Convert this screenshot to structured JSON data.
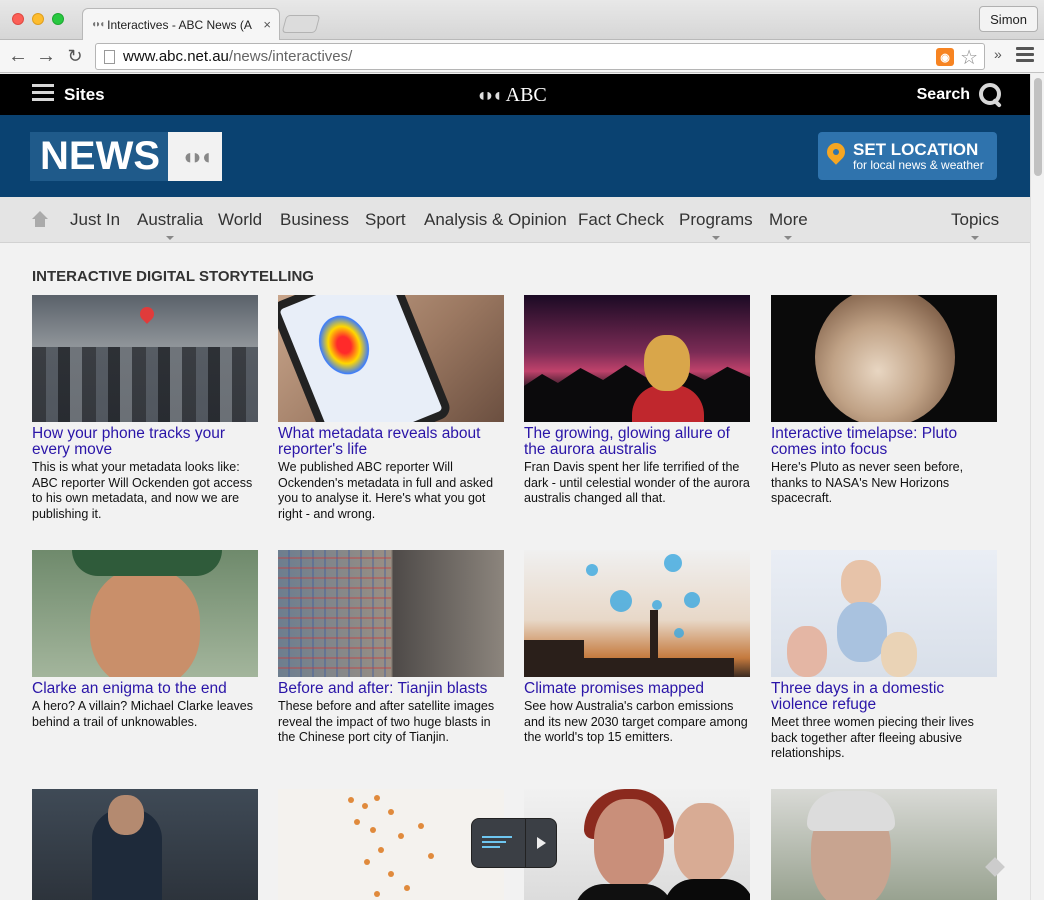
{
  "window": {
    "tab_title": "Interactives - ABC News (A",
    "tab_favicon": "abc-favicon-icon",
    "user_button": "Simon"
  },
  "toolbar": {
    "url_host": "www.abc.net.au",
    "url_path": "/news/interactives/",
    "extensions_label": "»"
  },
  "abc_bar": {
    "sites_label": "Sites",
    "logo_text": "ABC",
    "search_label": "Search"
  },
  "banner": {
    "news_logo": "NEWS",
    "set_location_main": "SET LOCATION",
    "set_location_sub": "for local news & weather"
  },
  "nav": {
    "items": [
      {
        "label": "Just In",
        "caret": false
      },
      {
        "label": "Australia",
        "caret": true
      },
      {
        "label": "World",
        "caret": false
      },
      {
        "label": "Business",
        "caret": false
      },
      {
        "label": "Sport",
        "caret": false
      },
      {
        "label": "Analysis & Opinion",
        "caret": false
      },
      {
        "label": "Fact Check",
        "caret": false
      },
      {
        "label": "Programs",
        "caret": true
      },
      {
        "label": "More",
        "caret": true
      }
    ],
    "topics_label": "Topics"
  },
  "section_title": "INTERACTIVE DIGITAL STORYTELLING",
  "cards": [
    {
      "title": "How your phone tracks your every move",
      "desc": "This is what your metadata looks like: ABC reporter Will Ockenden got access to his own metadata, and now we are publishing it."
    },
    {
      "title": "What metadata reveals about reporter's life",
      "desc": "We published ABC reporter Will Ockenden's metadata in full and asked you to analyse it. Here's what you got right - and wrong."
    },
    {
      "title": "The growing, glowing allure of the aurora australis",
      "desc": "Fran Davis spent her life terrified of the dark - until celestial wonder of the aurora australis changed all that."
    },
    {
      "title": "Interactive timelapse: Pluto comes into focus",
      "desc": "Here's Pluto as never seen before, thanks to NASA's New Horizons spacecraft."
    },
    {
      "title": "Clarke an enigma to the end",
      "desc": "A hero? A villain? Michael Clarke leaves behind a trail of unknowables."
    },
    {
      "title": "Before and after: Tianjin blasts",
      "desc": "These before and after satellite images reveal the impact of two huge blasts in the Chinese port city of Tianjin."
    },
    {
      "title": "Climate promises mapped",
      "desc": "See how Australia's carbon emissions and its new 2030 target compare among the world's top 15 emitters."
    },
    {
      "title": "Three days in a domestic violence refuge",
      "desc": "Meet three women piecing their lives back together after fleeing abusive relationships."
    }
  ],
  "colors": {
    "abc_bar": "#000000",
    "banner": "#0a4271",
    "link": "#2a15a8",
    "set_location": "#2f73ad"
  }
}
